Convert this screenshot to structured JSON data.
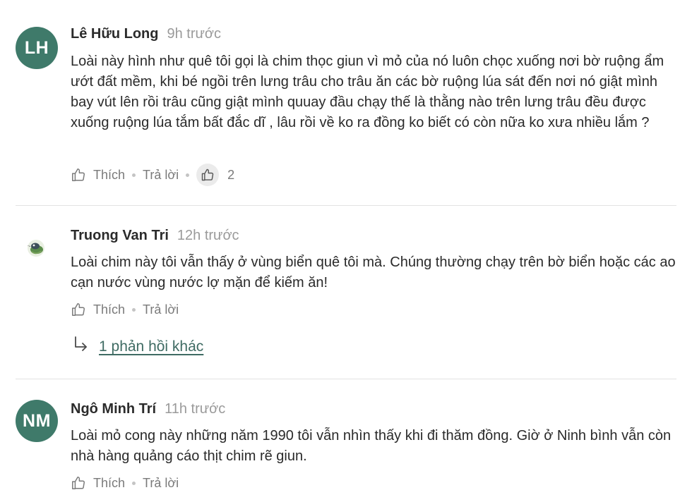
{
  "comments": [
    {
      "avatar_initials": "LH",
      "author": "Lê Hữu Long",
      "time": "9h trước",
      "text": "Loài này hình như quê tôi gọi là chim thọc giun vì mỏ của nó luôn chọc xuống nơi bờ ruộng ẩm ướt đất mềm, khi bé ngồi trên lưng trâu cho trâu ăn các bờ ruộng lúa sát đến nơi nó giật mình bay vút lên rồi trâu cũng giật mình quuay đầu chạy thế là thằng nào trên lưng trâu đều được xuống ruộng lúa tắm bất đắc dĩ , lâu rồi về ko ra đồng ko biết có còn nữa ko xưa nhiều lắm ?",
      "like_label": "Thích",
      "reply_label": "Trả lời",
      "like_count": "2"
    },
    {
      "author": "Truong Van Tri",
      "time": "12h trước",
      "text": "Loài chim này tôi vẫn thấy ở vùng biển quê tôi mà. Chúng thường chạy trên bờ biển hoặc các ao cạn nước vùng nước lợ mặn để kiếm ăn!",
      "like_label": "Thích",
      "reply_label": "Trả lời",
      "replies_link": "1 phản hồi khác"
    },
    {
      "avatar_initials": "NM",
      "author": "Ngô Minh Trí",
      "time": "11h trước",
      "text": "Loài mỏ cong này những năm 1990 tôi vẫn nhìn thấy khi đi thăm đồng. Giờ ở Ninh bình vẫn còn nhà hàng quảng cáo thịt chim rẽ giun.",
      "like_label": "Thích",
      "reply_label": "Trả lời"
    }
  ],
  "colors": {
    "avatar_bg": "#3f7a6a",
    "link": "#3f6b63",
    "muted": "#7a7a7a"
  }
}
